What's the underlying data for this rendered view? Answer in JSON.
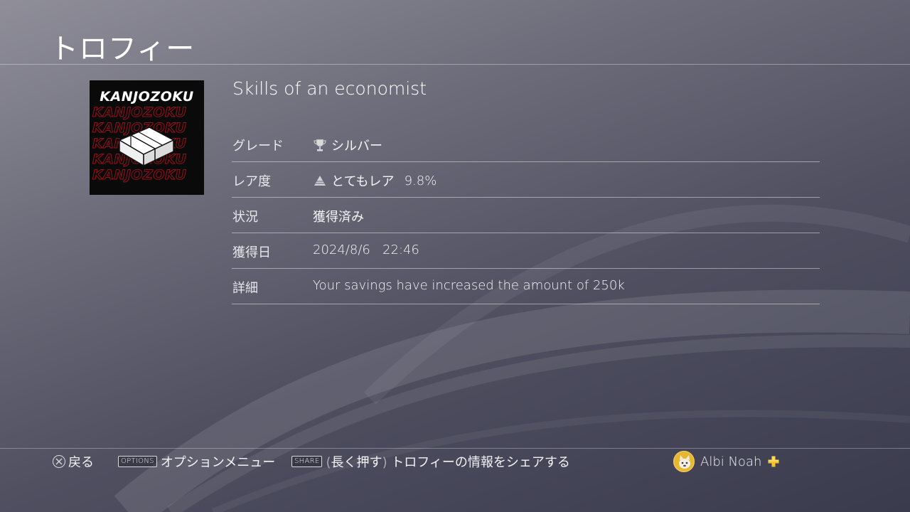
{
  "page": {
    "title": "トロフィー"
  },
  "trophy": {
    "art_logo": "KANJOZOKU",
    "name": "Skills of an economist",
    "rows": [
      {
        "label": "グレード",
        "value": "シルバー",
        "icon": "silver-trophy-icon"
      },
      {
        "label": "レア度",
        "value": "とてもレア",
        "percent": "9.8%",
        "icon": "rarity-pyramid-icon"
      },
      {
        "label": "状況",
        "value": "獲得済み"
      },
      {
        "label": "獲得日",
        "value": "2024/8/6   22:46"
      },
      {
        "label": "詳細",
        "value": "Your savings have increased the amount of 250k"
      }
    ]
  },
  "footer": {
    "back_label": "戻る",
    "options_key": "OPTIONS",
    "options_label": "オプションメニュー",
    "share_key": "SHARE",
    "share_label": "(長く押す) トロフィーの情報をシェアする",
    "user_name": "Albi Noah",
    "plus_icon": "playstation-plus-icon"
  },
  "colors": {
    "plus": "#f7c230",
    "art_red": "#b1121f",
    "avatar": "#e8b730"
  }
}
